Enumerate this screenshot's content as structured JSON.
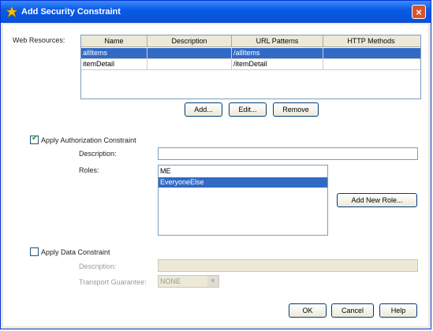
{
  "window": {
    "title": "Add Security Constraint",
    "close": "×"
  },
  "web_resources": {
    "label": "Web Resources:",
    "columns": [
      "Name",
      "Description",
      "URL Patterns",
      "HTTP Methods"
    ],
    "rows": [
      {
        "name": "allItems",
        "description": "",
        "url": "/allItems",
        "methods": "",
        "selected": true
      },
      {
        "name": "itemDetail",
        "description": "",
        "url": "/itemDetail",
        "methods": "",
        "selected": false
      }
    ],
    "buttons": {
      "add": "Add...",
      "edit": "Edit...",
      "remove": "Remove"
    }
  },
  "auth": {
    "checkbox_label": "Apply Authorization Constraint",
    "checked": true,
    "description_label": "Description:",
    "description_value": "",
    "roles_label": "Roles:",
    "roles": [
      {
        "name": "ME",
        "selected": false
      },
      {
        "name": "EveryoneElse",
        "selected": true
      }
    ],
    "add_role_button": "Add New Role..."
  },
  "data_constraint": {
    "checkbox_label": "Apply Data Constraint",
    "checked": false,
    "description_label": "Description:",
    "transport_label": "Transport Guarantee:",
    "transport_value": "NONE"
  },
  "footer": {
    "ok": "OK",
    "cancel": "Cancel",
    "help": "Help"
  }
}
